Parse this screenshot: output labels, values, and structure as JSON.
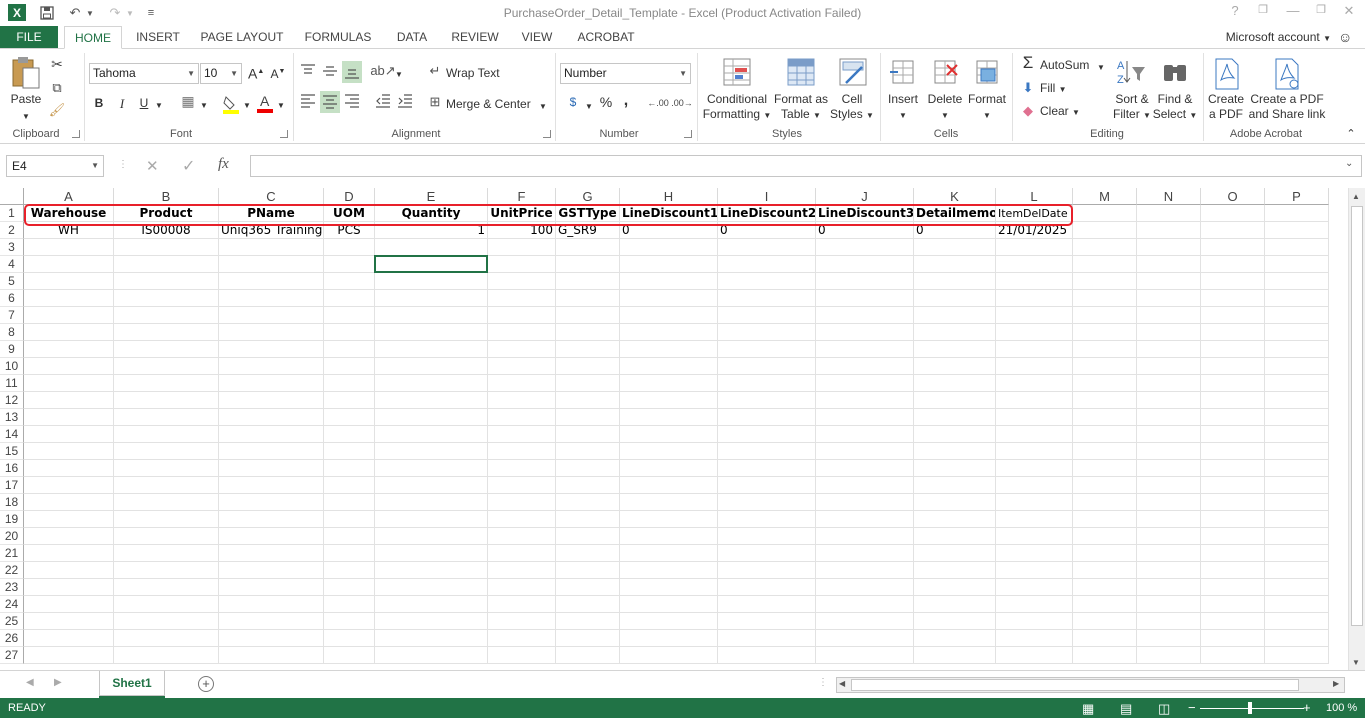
{
  "window": {
    "title": "PurchaseOrder_Detail_Template - Excel (Product Activation Failed)",
    "help": "?",
    "minimize": "—",
    "restore": "❐",
    "close": "✕"
  },
  "qat": {
    "excel_icon": "X",
    "save_icon": "save-icon",
    "undo": "↶",
    "redo": "↷",
    "customize": "≡"
  },
  "tabs": [
    {
      "label": "FILE"
    },
    {
      "label": "HOME"
    },
    {
      "label": "INSERT"
    },
    {
      "label": "PAGE LAYOUT"
    },
    {
      "label": "FORMULAS"
    },
    {
      "label": "DATA"
    },
    {
      "label": "REVIEW"
    },
    {
      "label": "VIEW"
    },
    {
      "label": "ACROBAT"
    }
  ],
  "account": "Microsoft account",
  "ribbon": {
    "clipboard": {
      "paste": "Paste",
      "label": "Clipboard"
    },
    "font": {
      "name": "Tahoma",
      "size": "10",
      "bold": "B",
      "italic": "I",
      "underline": "U",
      "label": "Font"
    },
    "alignment": {
      "wrap": "Wrap Text",
      "merge": "Merge & Center",
      "label": "Alignment"
    },
    "number": {
      "format": "Number",
      "percent": "%",
      "comma": ",",
      "label": "Number"
    },
    "styles": {
      "cond1": "Conditional",
      "cond2": "Formatting",
      "fmt1": "Format as",
      "fmt2": "Table",
      "cell1": "Cell",
      "cell2": "Styles",
      "label": "Styles"
    },
    "cells": {
      "insert": "Insert",
      "delete": "Delete",
      "format": "Format",
      "label": "Cells"
    },
    "editing": {
      "autosum": "AutoSum",
      "fill": "Fill",
      "clear": "Clear",
      "sort1": "Sort &",
      "sort2": "Filter",
      "find1": "Find &",
      "find2": "Select",
      "label": "Editing"
    },
    "acrobat": {
      "create1": "Create",
      "create2": "a PDF",
      "share1": "Create a PDF",
      "share2": "and Share link",
      "label": "Adobe Acrobat"
    }
  },
  "formula_bar": {
    "name_box": "E4",
    "cancel": "✕",
    "enter": "✓",
    "fx": "fx",
    "value": ""
  },
  "columns": [
    "A",
    "B",
    "C",
    "D",
    "E",
    "F",
    "G",
    "H",
    "I",
    "J",
    "K",
    "L",
    "M",
    "N",
    "O",
    "P"
  ],
  "rows": [
    "1",
    "2",
    "3",
    "4",
    "5",
    "6",
    "7",
    "8",
    "9",
    "10",
    "11",
    "12",
    "13",
    "14",
    "15",
    "16",
    "17",
    "18",
    "19",
    "20",
    "21",
    "22",
    "23",
    "24",
    "25",
    "26",
    "27"
  ],
  "sheet": {
    "headers": [
      "Warehouse",
      "Product",
      "PName",
      "UOM",
      "Quantity",
      "UnitPrice",
      "GSTType",
      "LineDiscount1",
      "LineDiscount2",
      "LineDiscount3",
      "Detailmemo",
      "ItemDelDate"
    ],
    "row2": [
      "WH",
      "IS00008",
      "Uniq365 Training",
      "PCS",
      "1",
      "100",
      "G_SR9",
      "0",
      "0",
      "0",
      "0",
      "21/01/2025"
    ]
  },
  "sheet_tabs": {
    "active": "Sheet1",
    "add": "+"
  },
  "status": {
    "mode": "READY",
    "zoom": "100 %",
    "zoom_minus": "−",
    "zoom_plus": "+"
  },
  "colors": {
    "accent": "#217346",
    "highlight": "#e8202a"
  }
}
